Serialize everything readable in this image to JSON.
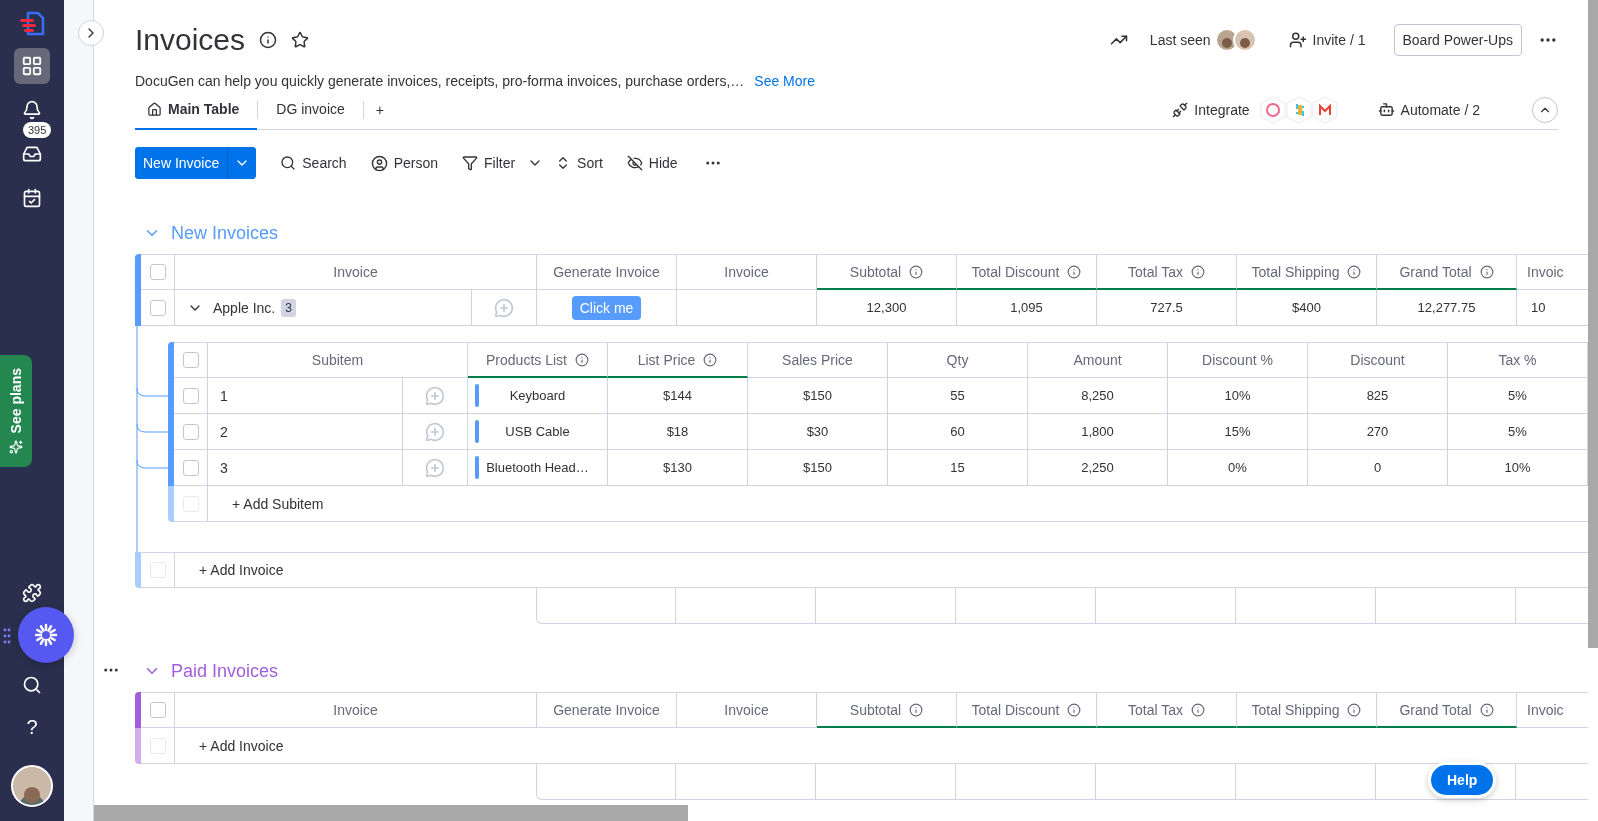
{
  "sidebar": {
    "top": [
      {
        "kind": "grid",
        "selected": true
      },
      {
        "kind": "bell",
        "selected": false
      },
      {
        "kind": "inbox",
        "selected": false,
        "badge": "395"
      },
      {
        "kind": "calendar",
        "selected": false
      }
    ],
    "bottom": [
      {
        "kind": "puzzle"
      },
      {
        "kind": "search"
      },
      {
        "kind": "help",
        "label": "?"
      }
    ]
  },
  "promo_tab": "See plans",
  "board": {
    "title": "Invoices",
    "description": "DocuGen can help you quickly generate invoices, receipts, pro-forma invoices, purchase orders,…",
    "see_more": "See More",
    "last_seen": "Last seen",
    "invite": "Invite / 1",
    "power_ups": "Board Power-Ups"
  },
  "views": [
    {
      "label": "Main Table",
      "selected": true
    },
    {
      "label": "DG invoice",
      "selected": false
    }
  ],
  "add_view": "+",
  "integrate": "Integrate",
  "automate": "Automate / 2",
  "toolbar": {
    "primary": "New Invoice",
    "items": [
      {
        "kind": "search",
        "label": "Search"
      },
      {
        "kind": "person",
        "label": "Person"
      },
      {
        "kind": "filter",
        "label": "Filter"
      },
      {
        "kind": "sort",
        "label": "Sort"
      },
      {
        "kind": "hide",
        "label": "Hide"
      }
    ]
  },
  "groups": [
    {
      "title": "New Invoices",
      "color": "#579bfc",
      "show_menu": false,
      "checked": false,
      "columns": [
        {
          "label": "Invoice",
          "info": false
        },
        {
          "label": "Generate Invoice",
          "info": false
        },
        {
          "label": "Invoice",
          "info": false
        },
        {
          "label": "Subtotal",
          "info": true
        },
        {
          "label": "Total Discount",
          "info": true
        },
        {
          "label": "Total Tax",
          "info": true
        },
        {
          "label": "Total Shipping",
          "info": true
        },
        {
          "label": "Grand Total",
          "info": true
        },
        {
          "label": "Invoic",
          "info": false
        }
      ],
      "items": [
        {
          "name": "Apple Inc.",
          "count": "3",
          "checked": false,
          "expanded": true,
          "button": "Click me",
          "values": [
            "12,300",
            "1,095",
            "727.5",
            "$400",
            "12,277.75",
            "10"
          ],
          "add_subitem": "+ Add Subitem",
          "subitems_checked": false,
          "subitem_columns": [
            {
              "label": "Subitem",
              "info": false
            },
            {
              "label": "Products List",
              "info": true
            },
            {
              "label": "List Price",
              "info": true
            },
            {
              "label": "Sales Price",
              "info": false
            },
            {
              "label": "Qty",
              "info": false
            },
            {
              "label": "Amount",
              "info": false
            },
            {
              "label": "Discount %",
              "info": false
            },
            {
              "label": "Discount",
              "info": false
            },
            {
              "label": "Tax %",
              "info": false
            }
          ],
          "subitems": [
            {
              "name": "1",
              "checked": false,
              "values": [
                "Keyboard",
                "$144",
                "$150",
                "55",
                "8,250",
                "10%",
                "825",
                "5%"
              ]
            },
            {
              "name": "2",
              "checked": false,
              "values": [
                "USB Cable",
                "$18",
                "$30",
                "60",
                "1,800",
                "15%",
                "270",
                "5%"
              ]
            },
            {
              "name": "3",
              "checked": false,
              "values": [
                "Bluetooth Head…",
                "$130",
                "$150",
                "15",
                "2,250",
                "0%",
                "0",
                "10%"
              ]
            }
          ]
        }
      ],
      "add_label": "+ Add Invoice"
    },
    {
      "title": "Paid Invoices",
      "color": "#a25ddc",
      "show_menu": true,
      "checked": false,
      "columns": [
        {
          "label": "Invoice",
          "info": false
        },
        {
          "label": "Generate Invoice",
          "info": false
        },
        {
          "label": "Invoice",
          "info": false
        },
        {
          "label": "Subtotal",
          "info": true
        },
        {
          "label": "Total Discount",
          "info": true
        },
        {
          "label": "Total Tax",
          "info": true
        },
        {
          "label": "Total Shipping",
          "info": true
        },
        {
          "label": "Grand Total",
          "info": true
        },
        {
          "label": "Invoic",
          "info": false
        }
      ],
      "add_label": "+ Add Invoice"
    }
  ],
  "help_button": "Help"
}
